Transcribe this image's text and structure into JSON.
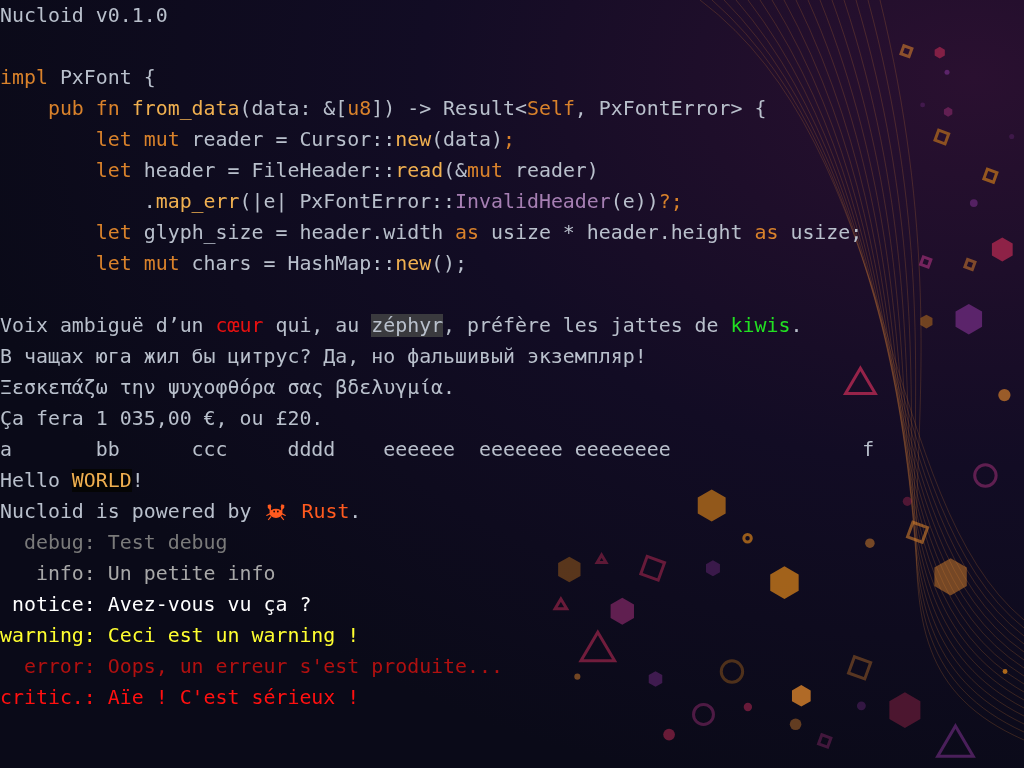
{
  "title": "Nucloid v0.1.0",
  "code": [
    {
      "segments": [
        {
          "text": "impl",
          "kind": "keyword"
        },
        {
          "text": " PxFont {",
          "kind": "plain"
        }
      ]
    },
    {
      "segments": [
        {
          "text": "    pub fn",
          "kind": "keyword"
        },
        {
          "text": " from_data",
          "kind": "function"
        },
        {
          "text": "(data: &[",
          "kind": "plain"
        },
        {
          "text": "u8",
          "kind": "keyword"
        },
        {
          "text": "]) -> Result<",
          "kind": "plain"
        },
        {
          "text": "Self",
          "kind": "keyword"
        },
        {
          "text": ", PxFontError> {",
          "kind": "plain"
        }
      ]
    },
    {
      "segments": [
        {
          "text": "        let mut",
          "kind": "keyword"
        },
        {
          "text": " reader = Cursor::",
          "kind": "plain"
        },
        {
          "text": "new",
          "kind": "function"
        },
        {
          "text": "(data)",
          "kind": "plain"
        },
        {
          "text": ";",
          "kind": "keyword"
        }
      ]
    },
    {
      "segments": [
        {
          "text": "        let",
          "kind": "keyword"
        },
        {
          "text": " header = FileHeader::",
          "kind": "plain"
        },
        {
          "text": "read",
          "kind": "function"
        },
        {
          "text": "(&",
          "kind": "plain"
        },
        {
          "text": "mut",
          "kind": "keyword"
        },
        {
          "text": " reader)",
          "kind": "plain"
        }
      ]
    },
    {
      "segments": [
        {
          "text": "            .",
          "kind": "plain"
        },
        {
          "text": "map_err",
          "kind": "function"
        },
        {
          "text": "(|e| PxFontError::",
          "kind": "plain"
        },
        {
          "text": "InvalidHeader",
          "kind": "variant"
        },
        {
          "text": "(e))",
          "kind": "plain"
        },
        {
          "text": "?;",
          "kind": "keyword"
        }
      ]
    },
    {
      "segments": [
        {
          "text": "        let",
          "kind": "keyword"
        },
        {
          "text": " glyph_size = header.width ",
          "kind": "plain"
        },
        {
          "text": "as",
          "kind": "keyword"
        },
        {
          "text": " usize * header.height ",
          "kind": "plain"
        },
        {
          "text": "as",
          "kind": "keyword"
        },
        {
          "text": " usize;",
          "kind": "plain"
        }
      ]
    },
    {
      "segments": [
        {
          "text": "        let mut",
          "kind": "keyword"
        },
        {
          "text": " chars = HashMap::",
          "kind": "plain"
        },
        {
          "text": "new",
          "kind": "function"
        },
        {
          "text": "();",
          "kind": "plain"
        }
      ]
    }
  ],
  "samples": [
    {
      "segments": [
        {
          "text": "Voix ambiguë d’un ",
          "kind": "plain"
        },
        {
          "text": "cœur",
          "kind": "red"
        },
        {
          "text": " qui, au ",
          "kind": "plain"
        },
        {
          "text": "zéphyr",
          "kind": "highlight"
        },
        {
          "text": ", préfère les jattes de ",
          "kind": "plain"
        },
        {
          "text": "kiwis",
          "kind": "green"
        },
        {
          "text": ".",
          "kind": "plain"
        }
      ]
    },
    {
      "segments": [
        {
          "text": "В чащах юга жил бы цитрус? Да, но фальшивый экземпляр!",
          "kind": "plain"
        }
      ]
    },
    {
      "segments": [
        {
          "text": "Ξεσκεπάζω την ψυχοφθόρα σας βδελυγμία.",
          "kind": "plain"
        }
      ]
    },
    {
      "segments": [
        {
          "text": "Ça fera 1 035,00 €, ou £20.",
          "kind": "plain"
        }
      ]
    },
    {
      "segments": [
        {
          "text": "a\tbb\tccc\tdddd\teeeeee\teeeeeee\teeeeeeee\t\tf",
          "kind": "plain"
        }
      ]
    },
    {
      "segments": [
        {
          "text": "Hello ",
          "kind": "plain"
        },
        {
          "text": "WORLD",
          "kind": "inverse"
        },
        {
          "text": "!",
          "kind": "plain"
        }
      ]
    },
    {
      "segments": [
        {
          "text": "Nucloid is powered by ",
          "kind": "plain"
        },
        {
          "kind": "crab"
        },
        {
          "text": " Rust",
          "kind": "rust"
        },
        {
          "text": ".",
          "kind": "plain"
        }
      ]
    }
  ],
  "log": [
    {
      "color": "#7a7a7a",
      "label": "debug:",
      "message": "Test debug"
    },
    {
      "color": "#a8a8a8",
      "label": "info:",
      "message": "Un petite info"
    },
    {
      "color": "#ffffff",
      "label": "notice:",
      "message": "Avez-vous vu ça ?"
    },
    {
      "color": "#ffff30",
      "label": "warning:",
      "message": "Ceci est un warning !"
    },
    {
      "color": "#b01010",
      "label": "error:",
      "message": "Oops, un erreur s'est produite..."
    },
    {
      "color": "#ff1010",
      "label": "critic.:",
      "message": "Aïe ! C'est sérieux !"
    }
  ]
}
